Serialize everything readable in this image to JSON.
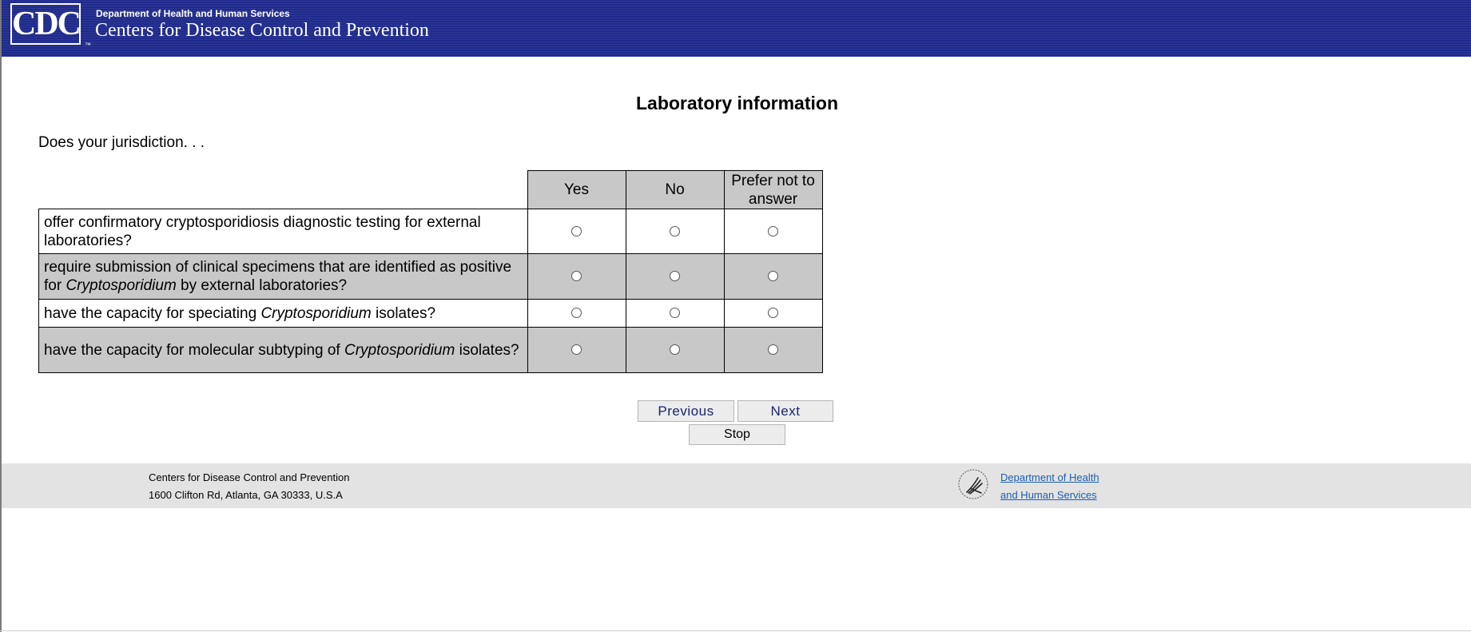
{
  "header": {
    "logo_text": "CDC",
    "logo_mark": "™",
    "department": "Department of Health and Human Services",
    "agency": "Centers for Disease Control and Prevention"
  },
  "page": {
    "title": "Laboratory information",
    "intro": "Does your jurisdiction. . ."
  },
  "table": {
    "columns": [
      "Yes",
      "No",
      "Prefer not to answer"
    ],
    "rows": [
      {
        "text_before": "offer confirmatory cryptosporidiosis diagnostic testing for external laboratories?",
        "italic": "",
        "text_after": ""
      },
      {
        "text_before": "require submission of clinical specimens that are identified as positive for ",
        "italic": "Cryptosporidium",
        "text_after": " by external laboratories?"
      },
      {
        "text_before": "have the capacity for speciating ",
        "italic": "Cryptosporidium",
        "text_after": " isolates?"
      },
      {
        "text_before": "have the capacity for molecular subtyping of ",
        "italic": "Cryptosporidium",
        "text_after": " isolates?"
      }
    ]
  },
  "buttons": {
    "previous": "Previous",
    "next": "Next",
    "stop": "Stop"
  },
  "footer": {
    "org": "Centers for Disease Control and Prevention",
    "address": "1600 Clifton Rd, Atlanta, GA 30333, U.S.A",
    "hhs_link_line1": "Department of Health",
    "hhs_link_line2": "and Human Services"
  },
  "colors": {
    "header_bg": "#1f2a8c",
    "table_shade": "#c8c8c8",
    "footer_bg": "#e3e3e3",
    "link": "#1a5fb4"
  }
}
